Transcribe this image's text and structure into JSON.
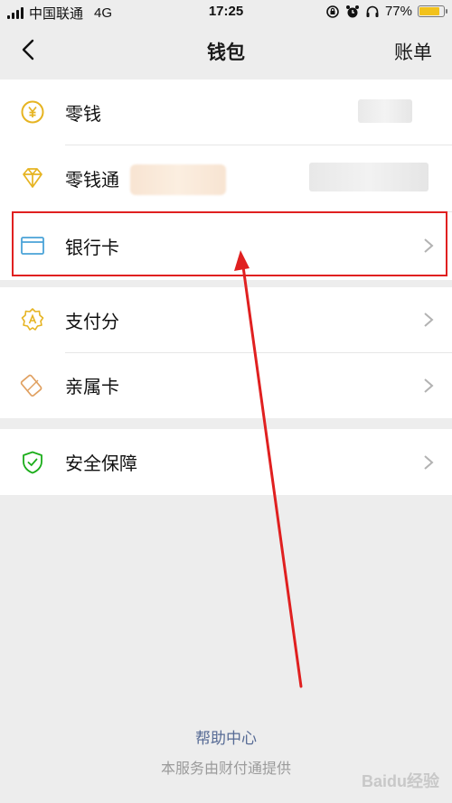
{
  "status_bar": {
    "carrier": "中国联通",
    "network": "4G",
    "time": "17:25",
    "battery": "77%",
    "battery_level": 0.77
  },
  "nav": {
    "title": "钱包",
    "right_action": "账单"
  },
  "groups": [
    {
      "items": [
        {
          "label": "零钱",
          "icon": "yuan-coin-icon"
        },
        {
          "label": "零钱通",
          "icon": "diamond-icon"
        },
        {
          "label": "银行卡",
          "icon": "bank-card-icon"
        }
      ]
    },
    {
      "items": [
        {
          "label": "支付分",
          "icon": "pay-score-badge-icon"
        },
        {
          "label": "亲属卡",
          "icon": "family-card-icon"
        }
      ]
    },
    {
      "items": [
        {
          "label": "安全保障",
          "icon": "shield-check-icon"
        }
      ]
    }
  ],
  "footer": {
    "help_link": "帮助中心",
    "provider_note": "本服务由财付通提供"
  },
  "watermark": "Baidu经验",
  "colors": {
    "background": "#ededed",
    "gold": "#e6b422",
    "blue_card": "#4aa3d8",
    "green_shield": "#1aad19",
    "link": "#576b95",
    "highlight": "#e02020"
  }
}
